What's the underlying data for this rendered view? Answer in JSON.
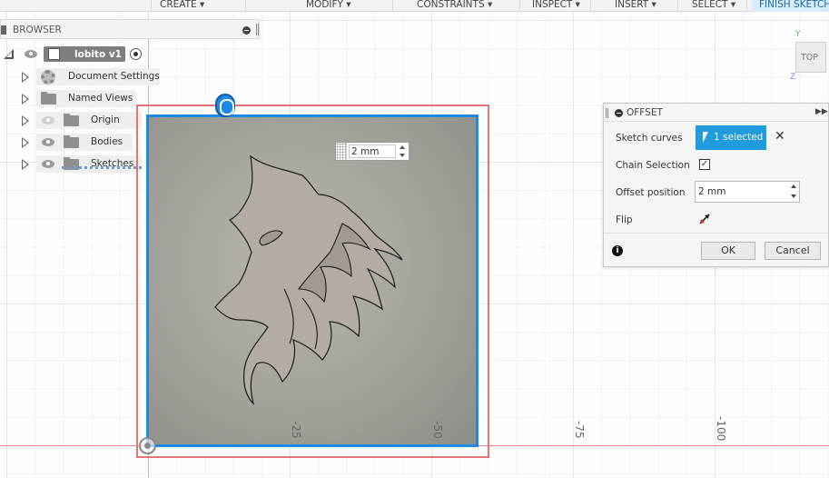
{
  "toolbar": {
    "create": "CREATE ▾",
    "modify": "MODIFY ▾",
    "constraints": "CONSTRAINTS ▾",
    "inspect": "INSPECT ▾",
    "insert": "INSERT ▾",
    "select": "SELECT ▾",
    "finish_sketch": "FINISH SKETCH"
  },
  "browser": {
    "title": "BROWSER",
    "root": "lobito v1",
    "items": [
      {
        "label": "Document Settings",
        "icon": "gear-icon"
      },
      {
        "label": "Named Views",
        "icon": "folder-icon"
      },
      {
        "label": "Origin",
        "icon": "folder-icon",
        "visible": false
      },
      {
        "label": "Bodies",
        "icon": "folder-icon",
        "visible": true
      },
      {
        "label": "Sketches",
        "icon": "folder-icon",
        "visible": true
      }
    ]
  },
  "canvas": {
    "dimension_value": "2 mm",
    "ticks": [
      "-25",
      "-50",
      "-75",
      "-100"
    ]
  },
  "viewcube": {
    "face": "TOP",
    "y_label": "Y",
    "z_label": "Z"
  },
  "offset_dialog": {
    "title": "OFFSET",
    "expand": "▶▶",
    "sketch_curves_label": "Sketch curves",
    "selected": "1 selected",
    "clear": "✕",
    "chain_selection_label": "Chain Selection",
    "chain_selection_checked": "✓",
    "offset_position_label": "Offset position",
    "offset_position_value": "2 mm",
    "flip_label": "Flip",
    "info": "i",
    "ok": "OK",
    "cancel": "Cancel"
  },
  "colors": {
    "accent": "#1f9bde",
    "selection": "#1e88e5",
    "offset_preview": "#e57373"
  }
}
